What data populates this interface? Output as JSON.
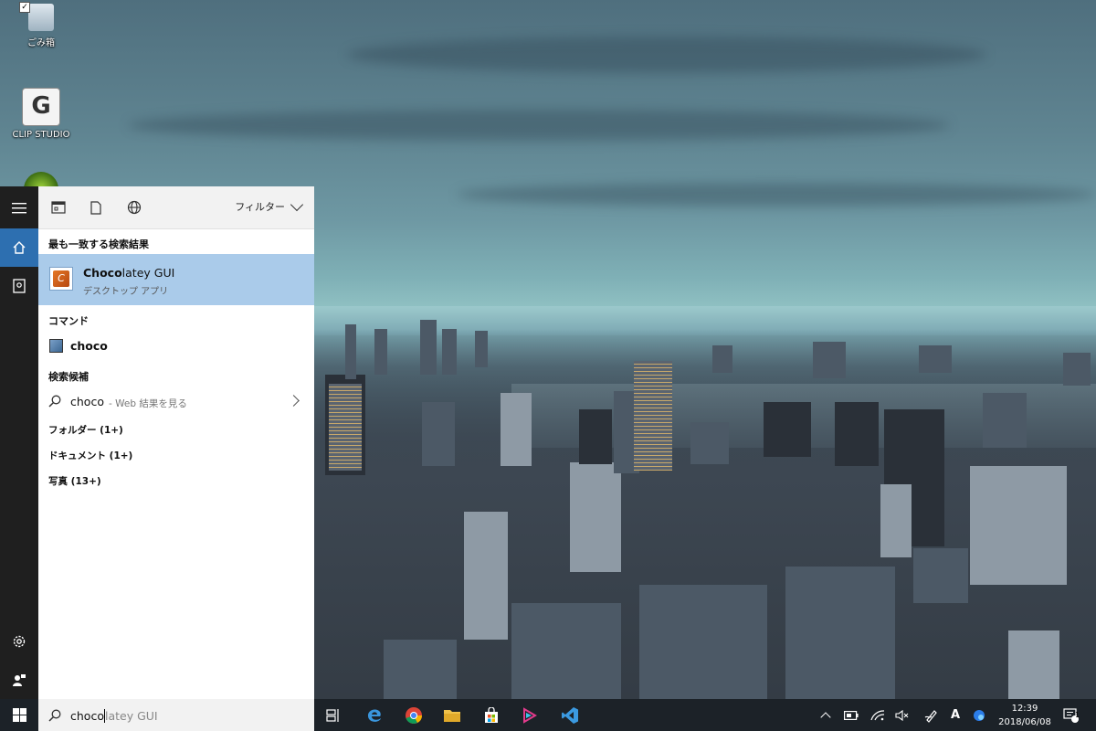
{
  "desktop": {
    "icons": [
      {
        "label": "ごみ箱"
      },
      {
        "label": "CLIP STUDIO"
      },
      {
        "label": ""
      }
    ]
  },
  "search_panel": {
    "filter_label": "フィルター",
    "best_match_heading": "最も一致する検索結果",
    "best_match": {
      "title_bold": "Choco",
      "title_rest": "latey GUI",
      "subtitle": "デスクトップ アプリ"
    },
    "commands_heading": "コマンド",
    "command_item": "choco",
    "suggestions_heading": "検索候補",
    "suggestion": {
      "query": "choco",
      "suffix": " - Web 結果を見る"
    },
    "categories": [
      {
        "label": "フォルダー (1+)"
      },
      {
        "label": "ドキュメント (1+)"
      },
      {
        "label": "写真 (13+)"
      }
    ]
  },
  "search_box": {
    "typed": "choco",
    "ghost": "latey GUI"
  },
  "taskbar": {
    "ime_indicator": "A",
    "clock_time": "12:39",
    "clock_date": "2018/06/08",
    "notification_count": "1"
  },
  "colors": {
    "accent": "#2d6fb0",
    "selected_result": "#aacbea",
    "rail_bg": "#1f1f1f",
    "taskbar_bg": "#1c2228"
  }
}
